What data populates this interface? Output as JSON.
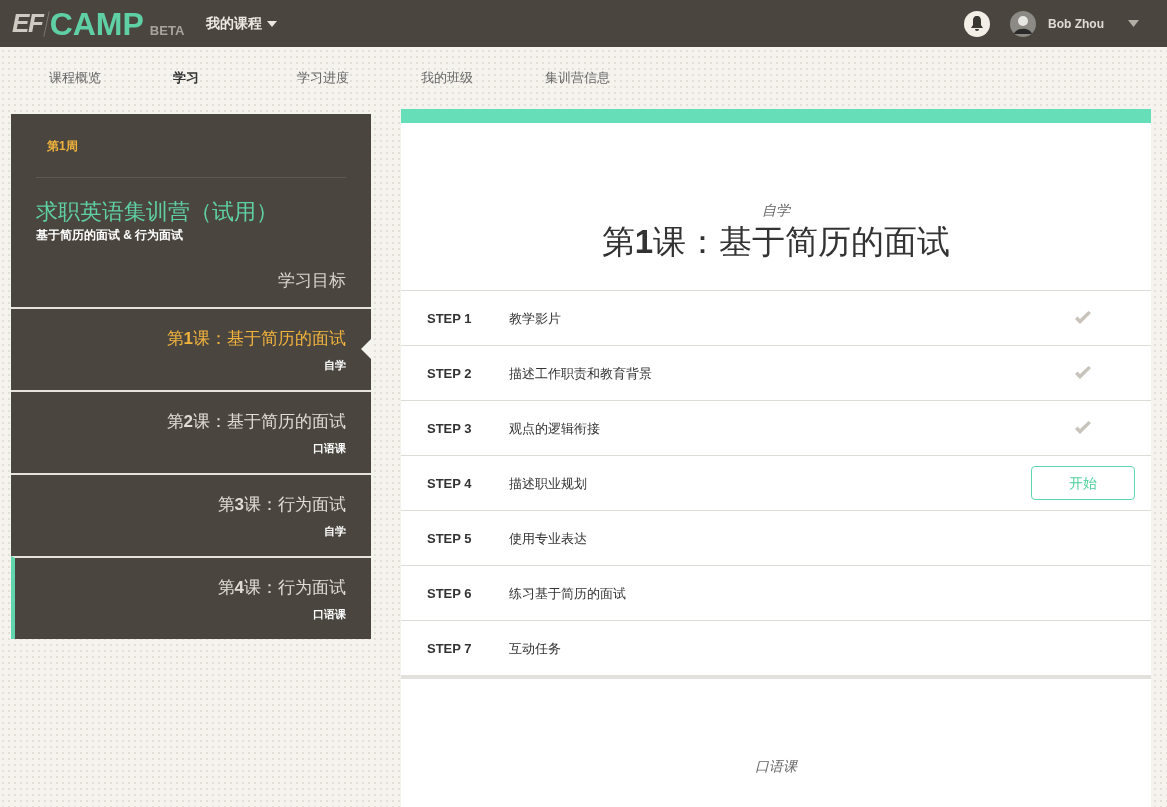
{
  "header": {
    "logo_mark": "EF",
    "logo": "CAMP",
    "logo_badge": "BETA",
    "course_menu": "我的课程",
    "user": "Bob Zhou"
  },
  "tabs": [
    {
      "label": "课程概览",
      "selected": false
    },
    {
      "label": "学习",
      "selected": true
    },
    {
      "label": "学习进度",
      "selected": false
    },
    {
      "label": "我的班级",
      "selected": false
    },
    {
      "label": "集训营信息",
      "selected": false
    }
  ],
  "sidebar": {
    "week": "第1周",
    "course_title": "求职英语集训营（试用）",
    "course_subtitle": "基于简历的面试 & 行为面试",
    "goals_link": "学习目标",
    "lessons": [
      {
        "title": "第**1**课：基于简历的面试",
        "type": "自学",
        "selected": true,
        "marked": false
      },
      {
        "title": "第**2**课：基于简历的面试",
        "type": "口语课",
        "selected": false,
        "marked": false
      },
      {
        "title": "第**3**课：行为面试",
        "type": "自学",
        "selected": false,
        "marked": false
      },
      {
        "title": "第**4**课：行为面试",
        "type": "口语课",
        "selected": false,
        "marked": true
      }
    ]
  },
  "lesson_cards": [
    {
      "type": "自学",
      "title": "第**1**课：基于简历的面试",
      "steps": [
        {
          "step": "STEP 1",
          "name": "教学影片",
          "kind": "done"
        },
        {
          "step": "STEP 2",
          "name": "描述工作职责和教育背景",
          "kind": "done"
        },
        {
          "step": "STEP 3",
          "name": "观点的逻辑衔接",
          "kind": "done"
        },
        {
          "step": "STEP 4",
          "name": "描述职业规划",
          "kind": "start",
          "action": "开始"
        },
        {
          "step": "STEP 5",
          "name": "使用专业表达",
          "kind": "none"
        },
        {
          "step": "STEP 6",
          "name": "练习基于简历的面试",
          "kind": "none"
        },
        {
          "step": "STEP 7",
          "name": "互动任务",
          "kind": "none"
        }
      ]
    },
    {
      "type": "口语课"
    }
  ],
  "progress": {
    "level": 1
  }
}
